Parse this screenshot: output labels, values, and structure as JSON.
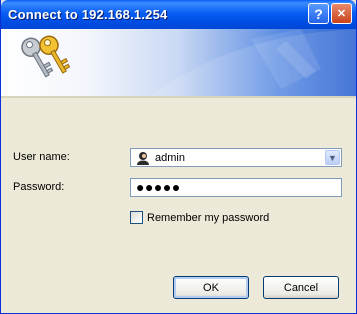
{
  "window": {
    "title": "Connect to 192.168.1.254"
  },
  "titlebar": {
    "help_glyph": "?",
    "close_glyph": "✕"
  },
  "form": {
    "user_label": "User name:",
    "user_value": "admin",
    "password_label": "Password:",
    "password_value": "●●●●●",
    "remember_label": "Remember my password",
    "remember_checked": false
  },
  "buttons": {
    "ok": "OK",
    "cancel": "Cancel"
  },
  "icons": {
    "banner": "keys-icon",
    "user": "user-icon",
    "dropdown": "chevron-down-icon"
  },
  "colors": {
    "titlebar": "#0a5ef3",
    "dialog_bg": "#ece9d8",
    "field_border": "#7f9db9"
  }
}
